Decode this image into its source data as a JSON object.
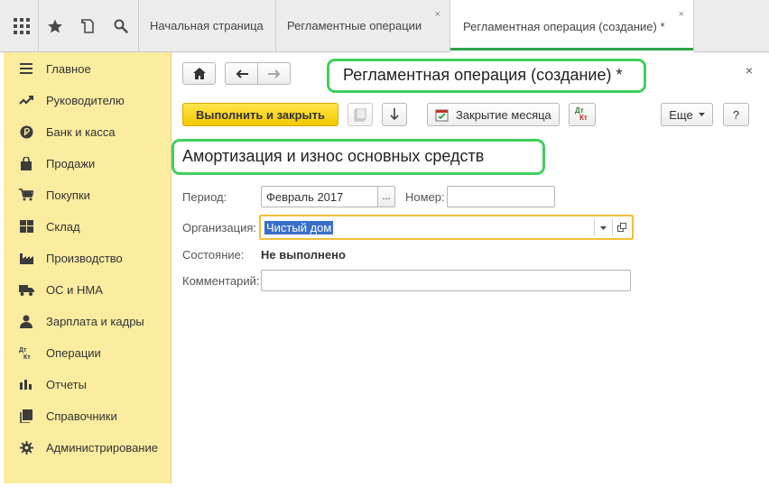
{
  "tabs": [
    {
      "label": "Начальная страница"
    },
    {
      "label": "Регламентные операции",
      "close": "×"
    },
    {
      "label": "Регламентная операция (создание) *",
      "close": "×"
    }
  ],
  "sidebar": {
    "items": [
      {
        "label": "Главное",
        "icon": "menu-lines-icon"
      },
      {
        "label": "Руководителю",
        "icon": "trend-up-icon"
      },
      {
        "label": "Банк и касса",
        "icon": "ruble-icon"
      },
      {
        "label": "Продажи",
        "icon": "shopping-bag-icon"
      },
      {
        "label": "Покупки",
        "icon": "shopping-cart-icon"
      },
      {
        "label": "Склад",
        "icon": "warehouse-icon"
      },
      {
        "label": "Производство",
        "icon": "factory-icon"
      },
      {
        "label": "ОС и НМА",
        "icon": "truck-icon"
      },
      {
        "label": "Зарплата и кадры",
        "icon": "person-icon"
      },
      {
        "label": "Операции",
        "icon": "dt-kt-icon"
      },
      {
        "label": "Отчеты",
        "icon": "bar-chart-icon"
      },
      {
        "label": "Справочники",
        "icon": "book-icon"
      },
      {
        "label": "Администрирование",
        "icon": "gear-icon"
      }
    ]
  },
  "window": {
    "title": "Регламентная операция (создание) *",
    "close": "×"
  },
  "toolbar": {
    "execute_label": "Выполнить и закрыть",
    "month_close_label": "Закрытие месяца",
    "more_label": "Еще",
    "help_label": "?",
    "dtkt_top": "Дт",
    "dtkt_bottom": "Кт"
  },
  "operation": {
    "heading": "Амортизация и износ основных средств"
  },
  "form": {
    "period_label": "Период:",
    "period_value": "Февраль 2017",
    "period_button": "...",
    "number_label": "Номер:",
    "number_value": "",
    "org_label": "Организация:",
    "org_value": "Чистый дом",
    "state_label": "Состояние:",
    "state_value": "Не выполнено",
    "comment_label": "Комментарий:",
    "comment_value": ""
  },
  "colors": {
    "sidebar_bg": "#fbeca0",
    "primary_button": "#f4c800",
    "highlight_green": "#3fd05a",
    "active_tab_underline": "#2fa34a",
    "org_field_border": "#f0bf3a",
    "selection": "#3a6fc9"
  }
}
